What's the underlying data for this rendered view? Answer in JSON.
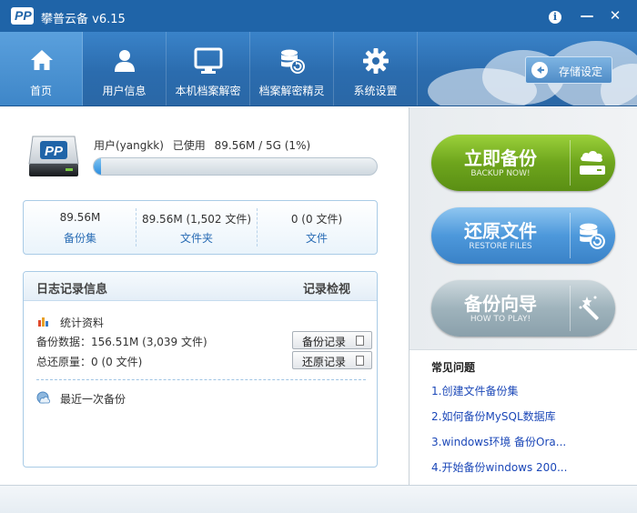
{
  "window": {
    "title": "攀普云备 v6.15",
    "logo_text": "PP",
    "info_glyph": "i",
    "min_glyph": "—",
    "close_glyph": "✕"
  },
  "nav": {
    "items": [
      {
        "label": "首页",
        "icon": "home-icon",
        "active": true
      },
      {
        "label": "用户信息",
        "icon": "user-icon",
        "active": false
      },
      {
        "label": "本机档案解密",
        "icon": "monitor-icon",
        "active": false
      },
      {
        "label": "档案解密精灵",
        "icon": "database-restore-icon",
        "active": false
      },
      {
        "label": "系统设置",
        "icon": "gear-icon",
        "active": false
      }
    ],
    "storage_button": "存储设定"
  },
  "account": {
    "user_label": "用户(yangkk)",
    "used_label": "已使用",
    "usage_text": "89.56M / 5G (1%)",
    "usage_fraction": 0.01
  },
  "stats": [
    {
      "value": "89.56M",
      "label": "备份集"
    },
    {
      "value": "89.56M  (1,502 文件)",
      "label": "文件夹"
    },
    {
      "value": "0  (0 文件)",
      "label": "文件"
    }
  ],
  "log": {
    "title": "日志记录信息",
    "view_link": "记录检视",
    "stats_heading": "统计资料",
    "backup_data": "备份数据：156.51M  (3,039 文件)",
    "restore_total": "总还原量：0  (0 文件)",
    "backup_record_btn": "备份记录",
    "restore_record_btn": "还原记录",
    "last_backup": "最近一次备份"
  },
  "actions": {
    "backup": {
      "main": "立即备份",
      "sub": "BACKUP NOW!"
    },
    "restore": {
      "main": "还原文件",
      "sub": "RESTORE FILES"
    },
    "wizard": {
      "main": "备份向导",
      "sub": "HOW TO PLAY!"
    }
  },
  "faq": {
    "title": "常见问题",
    "items": [
      "1.创建文件备份集",
      "2.如何备份MySQL数据库",
      "3.windows环境 备份Ora...",
      "4.开始备份windows 200..."
    ]
  },
  "colors": {
    "titlebar": "#1f64a8",
    "nav": "#2b6cae",
    "link": "#1c48b8",
    "backup_green": "#6ea51d",
    "restore_blue": "#4d98db",
    "wizard_gray": "#9fb3bc"
  }
}
